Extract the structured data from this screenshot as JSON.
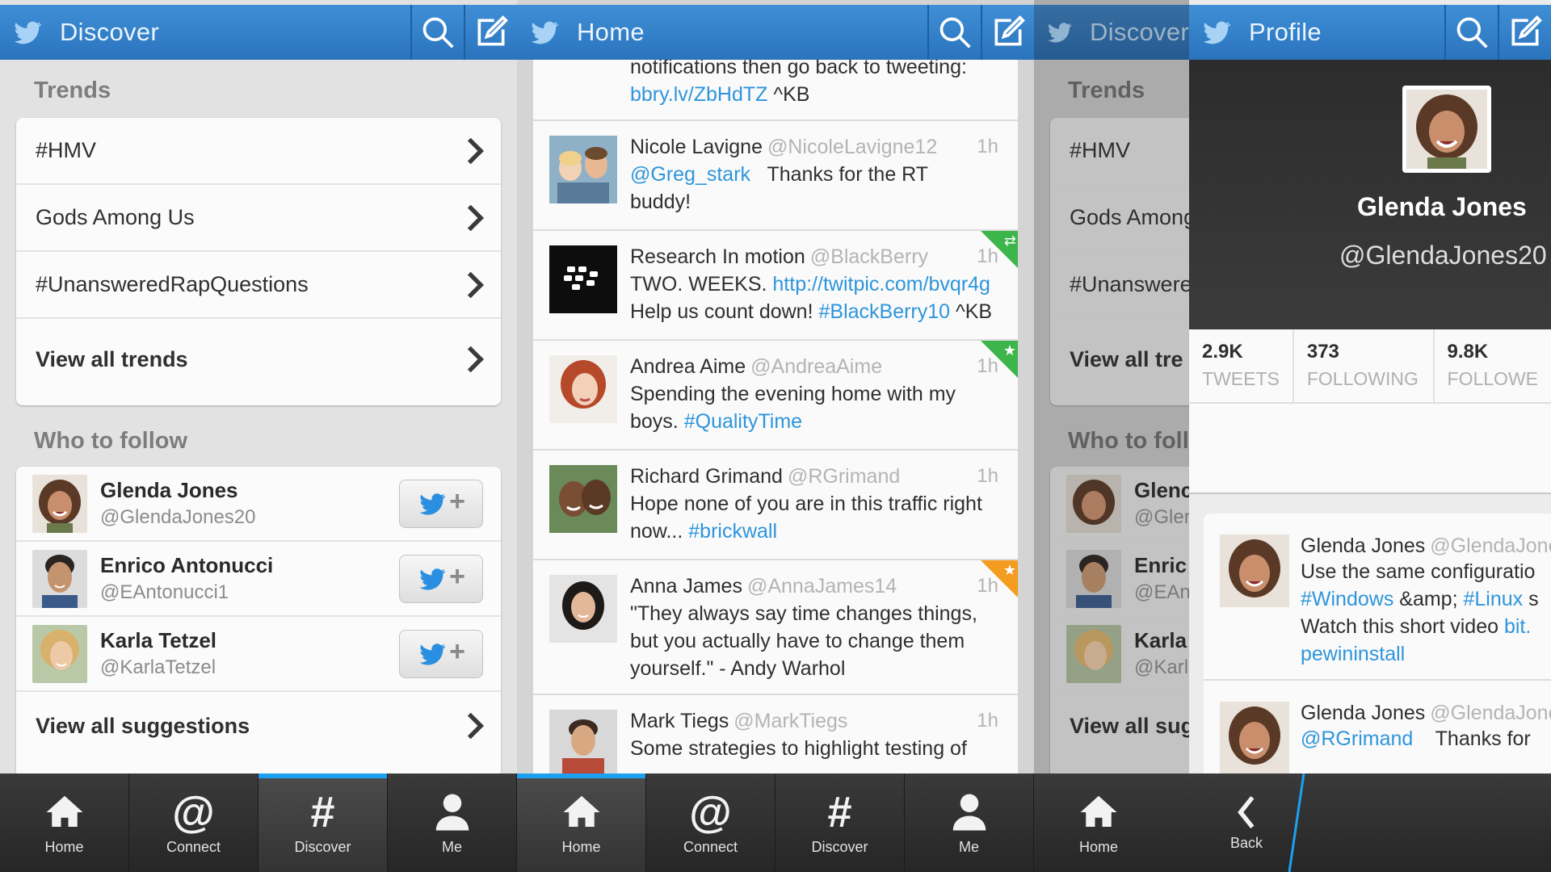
{
  "discover": {
    "title": "Discover",
    "trends_heading": "Trends",
    "trends": [
      {
        "label": "#HMV"
      },
      {
        "label": "Gods Among Us"
      },
      {
        "label": "#UnansweredRapQuestions"
      },
      {
        "label": "View all trends"
      }
    ],
    "who_heading": "Who to follow",
    "suggestions": [
      {
        "name": "Glenda Jones",
        "handle": "@GlendaJones20"
      },
      {
        "name": "Enrico Antonucci",
        "handle": "@EAntonucci1"
      },
      {
        "name": "Karla Tetzel",
        "handle": "@KarlaTetzel"
      }
    ],
    "view_all_suggestions": "View all suggestions"
  },
  "home": {
    "title": "Home",
    "partial_top": {
      "line1": "notifications then go back to tweeting:",
      "link": "bbry.lv/ZbHdTZ",
      "tail": "^KB"
    },
    "tweets": [
      {
        "name": "Nicole Lavigne",
        "handle": "@NicoleLavigne12",
        "time": "1h",
        "mention": "@Greg_stark",
        "text": "Thanks for the RT",
        "text2": "buddy!"
      },
      {
        "name": "Research In motion",
        "handle": "@BlackBerry",
        "time": "1h",
        "text": "TWO. WEEKS.",
        "link": "http://twitpic.com/bvqr4g",
        "text2": "Help us count down!",
        "tag": "#BlackBerry10",
        "tail": "^KB"
      },
      {
        "name": "Andrea Aime",
        "handle": "@AndreaAime",
        "time": "1h",
        "text": "Spending the evening home with my",
        "text2": "boys.",
        "tag": "#QualityTime"
      },
      {
        "name": "Richard Grimand",
        "handle": "@RGrimand",
        "time": "1h",
        "text": "Hope none of you are in this traffic right",
        "text2": "now...",
        "tag": "#brickwall"
      },
      {
        "name": "Anna James",
        "handle": "@AnnaJames14",
        "time": "1h",
        "text": "\"They always say time changes things,",
        "text2": "but you actually have to change them",
        "text3": "yourself.\" - Andy Warhol"
      },
      {
        "name": "Mark Tiegs",
        "handle": "@MarkTiegs",
        "time": "1h",
        "text": "Some strategies to highlight testing of"
      }
    ]
  },
  "discover_dim": {
    "title": "Discover",
    "trends_heading": "Trends",
    "trends": [
      "#HMV",
      "Gods Among",
      "#Unanswere",
      "View all tre"
    ],
    "who_heading": "Who to foll",
    "names": [
      "Glenc",
      "Enric",
      "Karla"
    ],
    "handles": [
      "@Gler",
      "@EAn",
      "@Karl"
    ],
    "view_all": "View all sug"
  },
  "profile": {
    "title": "Profile",
    "name": "Glenda Jones",
    "handle": "@GlendaJones20",
    "stats": [
      {
        "num": "2.9K",
        "label": "TWEETS"
      },
      {
        "num": "373",
        "label": "FOLLOWING"
      },
      {
        "num": "9.8K",
        "label": "FOLLOWE"
      }
    ],
    "tweets": [
      {
        "name": "Glenda Jones",
        "handle": "@GlendaJone",
        "line1": "Use the same configuratio",
        "tag1": "#Windows",
        "amp": "&amp;",
        "tag2": "#Linux",
        "tail2": "s",
        "line3": "Watch this short video",
        "link3": "bit.",
        "line4": "pewininstall"
      },
      {
        "name": "Glenda Jones",
        "handle": "@GlendaJone",
        "mention": "@RGrimand",
        "text": "Thanks for"
      }
    ],
    "back_label": "Back"
  },
  "tabs": [
    {
      "label": "Home",
      "icon": "home-icon"
    },
    {
      "label": "Connect",
      "icon": "at-icon"
    },
    {
      "label": "Discover",
      "icon": "hash-icon"
    },
    {
      "label": "Me",
      "icon": "person-icon"
    },
    {
      "label": "Home",
      "icon": "home-icon"
    },
    {
      "label": "Connect",
      "icon": "at-icon"
    },
    {
      "label": "Discover",
      "icon": "hash-icon"
    },
    {
      "label": "Me",
      "icon": "person-icon"
    },
    {
      "label": "Home",
      "icon": "home-icon"
    }
  ],
  "colors": {
    "accent": "#2a74bd",
    "link": "#2e95dc",
    "tab_active": "#1da0f0"
  }
}
